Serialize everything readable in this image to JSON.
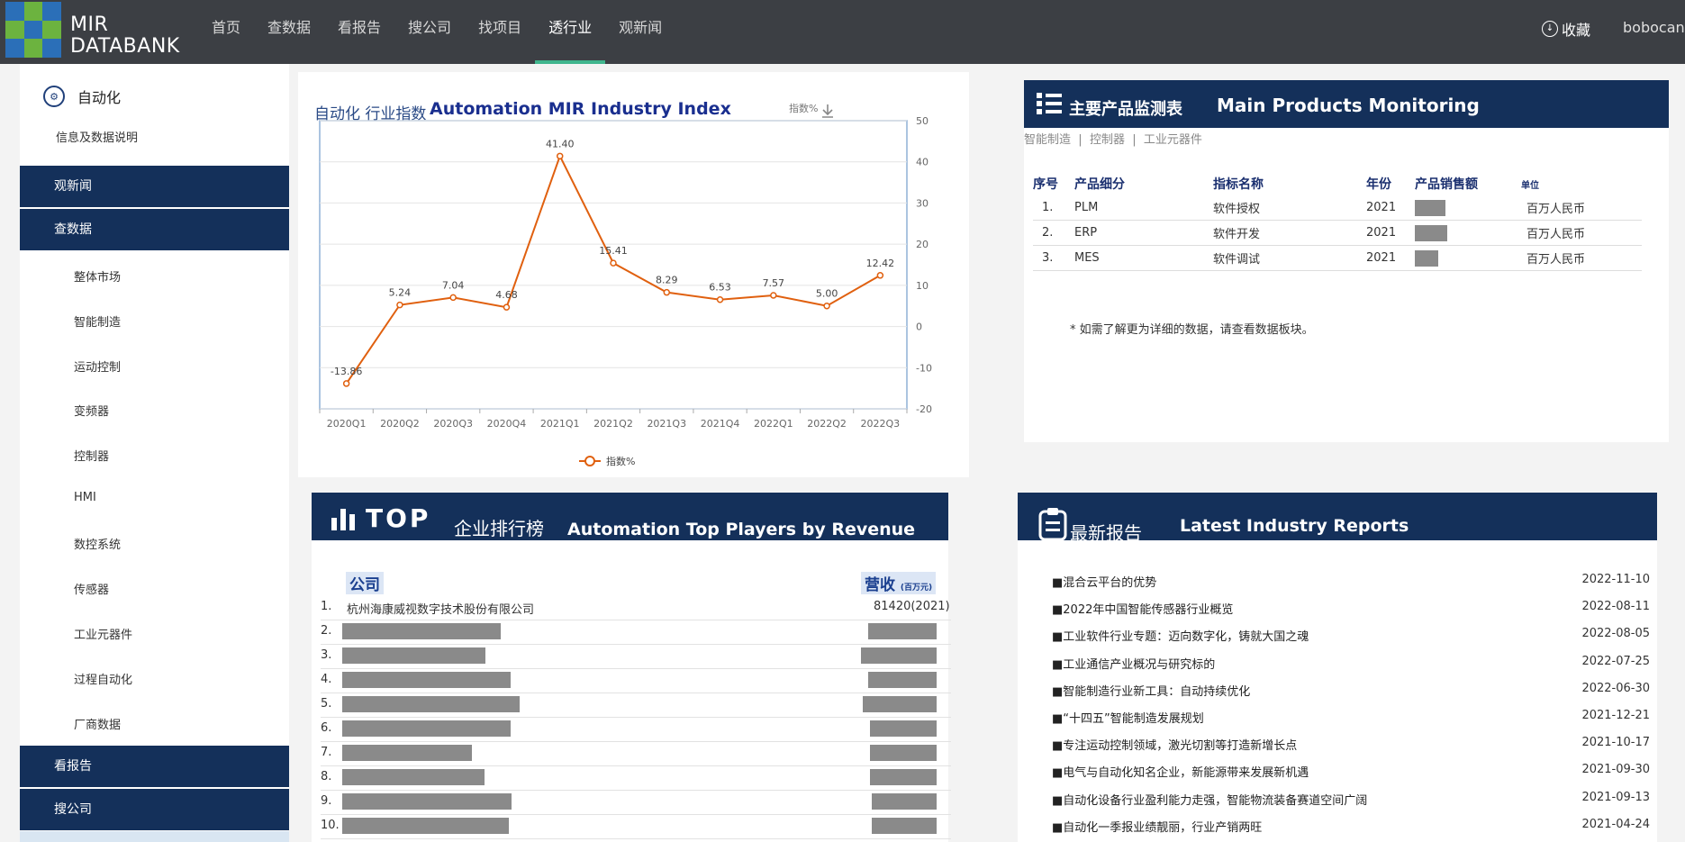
{
  "header": {
    "logo_line1": "MIR",
    "logo_line2": "DATABANK",
    "nav": [
      {
        "label": "首页",
        "active": false
      },
      {
        "label": "查数据",
        "active": false
      },
      {
        "label": "看报告",
        "active": false
      },
      {
        "label": "搜公司",
        "active": false
      },
      {
        "label": "找项目",
        "active": false
      },
      {
        "label": "透行业",
        "active": true
      },
      {
        "label": "观新闻",
        "active": false
      }
    ],
    "favorites_label": "收藏",
    "user_name": "bobocan"
  },
  "sidebar": {
    "industry": "自动化",
    "info_link": "信息及数据说明",
    "sections": {
      "news": "观新闻",
      "data": "查数据",
      "reports": "看报告",
      "companies": "搜公司"
    },
    "data_items": [
      "整体市场",
      "智能制造",
      "运动控制",
      "变频器",
      "控制器",
      "HMI",
      "数控系统",
      "传感器",
      "工业元器件",
      "过程自动化",
      "厂商数据"
    ]
  },
  "index_chart": {
    "title_cn": "自动化 行业指数",
    "title_en": "Automation MIR Industry Index",
    "y_unit": "指数%"
  },
  "chart_data": {
    "type": "line",
    "x": [
      "2020Q1",
      "2020Q2",
      "2020Q3",
      "2020Q4",
      "2021Q1",
      "2021Q2",
      "2021Q3",
      "2021Q4",
      "2022Q1",
      "2022Q2",
      "2022Q3"
    ],
    "series": [
      {
        "name": "指数%",
        "values": [
          -13.86,
          5.24,
          7.04,
          4.68,
          41.4,
          15.41,
          8.29,
          6.53,
          7.57,
          5.0,
          12.42
        ],
        "labels": [
          "-13.86",
          "5.24",
          "7.04",
          "4.68",
          "41.40",
          "15.41",
          "8.29",
          "6.53",
          "7.57",
          "5.00",
          "12.42"
        ]
      }
    ],
    "ylim": [
      -20,
      50
    ],
    "yticks": [
      50,
      40,
      30,
      20,
      10,
      0,
      -10,
      -20
    ],
    "color": "#e0600f",
    "grid": true,
    "legend": "bottom-center"
  },
  "products": {
    "title_cn": "主要产品监测表",
    "title_en": "Main Products Monitoring",
    "crumbs": [
      "智能制造",
      "控制器",
      "工业元器件"
    ],
    "crumb_sep": "|",
    "columns": [
      "序号",
      "产品细分",
      "指标名称",
      "年份",
      "产品销售额",
      "单位"
    ],
    "rows": [
      {
        "no": "1.",
        "segment": "PLM",
        "metric": "软件授权",
        "year": "2021",
        "unit": "百万人民币"
      },
      {
        "no": "2.",
        "segment": "ERP",
        "metric": "软件开发",
        "year": "2021",
        "unit": "百万人民币"
      },
      {
        "no": "3.",
        "segment": "MES",
        "metric": "软件调试",
        "year": "2021",
        "unit": "百万人民币"
      }
    ],
    "note": "* 如需了解更为详细的数据，请查看数据板块。"
  },
  "top_players": {
    "title_top": "TOP",
    "title_cn": "企业排行榜",
    "title_en": "Automation Top Players by Revenue",
    "col_company": "公司",
    "col_revenue": "营收",
    "col_revenue_unit": "(百万元)",
    "rows": [
      {
        "no": "1.",
        "company": "杭州海康威视数字技术股份有限公司",
        "revenue": "81420(2021)"
      },
      {
        "no": "2."
      },
      {
        "no": "3."
      },
      {
        "no": "4."
      },
      {
        "no": "5."
      },
      {
        "no": "6."
      },
      {
        "no": "7."
      },
      {
        "no": "8."
      },
      {
        "no": "9."
      },
      {
        "no": "10."
      }
    ]
  },
  "reports": {
    "title_cn": "最新报告",
    "title_en": "Latest Industry Reports",
    "items": [
      {
        "title": "■混合云平台的优势",
        "date": "2022-11-10"
      },
      {
        "title": "■2022年中国智能传感器行业概览",
        "date": "2022-08-11"
      },
      {
        "title": "■工业软件行业专题：迈向数字化，铸就大国之魂",
        "date": "2022-08-05"
      },
      {
        "title": "■工业通信产业概况与研究标的",
        "date": "2022-07-25"
      },
      {
        "title": "■智能制造行业新工具：自动持续优化",
        "date": "2022-06-30"
      },
      {
        "title": "■“十四五”智能制造发展规划",
        "date": "2021-12-21"
      },
      {
        "title": "■专注运动控制领域，激光切割等打造新增长点",
        "date": "2021-10-17"
      },
      {
        "title": "■电气与自动化知名企业，新能源带来发展新机遇",
        "date": "2021-09-30"
      },
      {
        "title": "■自动化设备行业盈利能力走强，智能物流装备赛道空间广阔",
        "date": "2021-09-13"
      },
      {
        "title": "■自动化一季报业绩靓丽，行业产销两旺",
        "date": "2021-04-24"
      }
    ]
  }
}
